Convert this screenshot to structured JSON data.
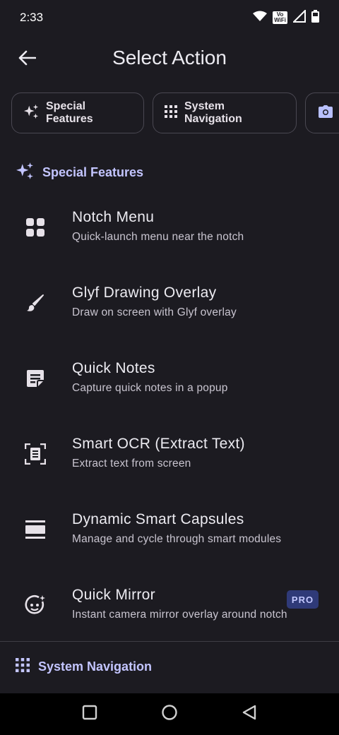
{
  "status_bar": {
    "time": "2:33",
    "volte_top": "Vo",
    "volte_bottom": "WiFi"
  },
  "app_bar": {
    "title": "Select Action"
  },
  "chips": [
    {
      "label": "Special Features",
      "icon": "sparkle-icon"
    },
    {
      "label": "System Navigation",
      "icon": "grid-icon"
    },
    {
      "label": "",
      "icon": "camera-icon"
    }
  ],
  "sections": [
    {
      "header": "Special Features",
      "icon": "sparkle-icon",
      "items": [
        {
          "title": "Notch Menu",
          "subtitle": "Quick-launch menu near the notch",
          "icon": "dashboard-icon"
        },
        {
          "title": "Glyf Drawing Overlay",
          "subtitle": "Draw on screen with Glyf overlay",
          "icon": "brush-icon"
        },
        {
          "title": "Quick Notes",
          "subtitle": "Capture quick notes in a popup",
          "icon": "sticky-note-icon"
        },
        {
          "title": "Smart OCR (Extract Text)",
          "subtitle": "Extract text from screen",
          "icon": "document-scanner-icon"
        },
        {
          "title": "Dynamic Smart Capsules",
          "subtitle": "Manage and cycle through smart modules",
          "icon": "view-agenda-icon"
        },
        {
          "title": "Quick Mirror",
          "subtitle": "Instant camera mirror overlay around notch",
          "icon": "face-sparkle-icon",
          "badge": "PRO"
        }
      ]
    },
    {
      "header": "System Navigation",
      "icon": "grid-icon"
    }
  ],
  "colors": {
    "background": "#1c1b21",
    "accent": "#c3c5ff",
    "badge_bg": "#2f3a78"
  }
}
